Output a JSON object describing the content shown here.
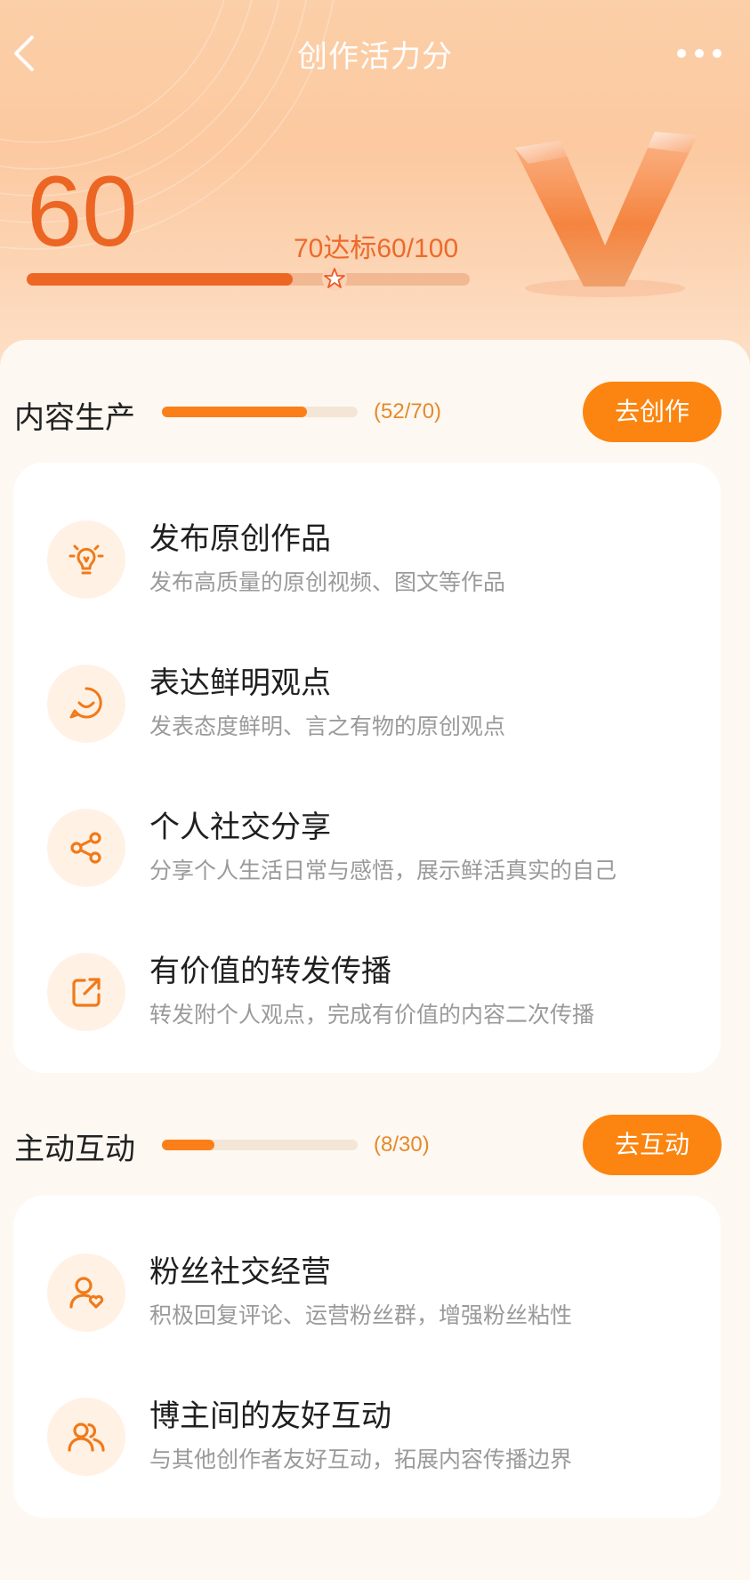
{
  "header": {
    "title": "创作活力分",
    "back_icon": "back-chevron-icon",
    "more_icon": "more-dots-icon"
  },
  "score": {
    "value": "60",
    "target_text": "70达标60/100",
    "current": 60,
    "max": 100,
    "target": 70,
    "logo_icon": "v-badge-icon"
  },
  "sections": [
    {
      "title": "内容生产",
      "count": "(52/70)",
      "progress": 0.743,
      "button": "去创作",
      "items": [
        {
          "title": "发布原创作品",
          "desc": "发布高质量的原创视频、图文等作品",
          "icon": "lightbulb-icon"
        },
        {
          "title": "表达鲜明观点",
          "desc": "发表态度鲜明、言之有物的原创观点",
          "icon": "smile-chat-icon"
        },
        {
          "title": "个人社交分享",
          "desc": "分享个人生活日常与感悟，展示鲜活真实的自己",
          "icon": "share-icon"
        },
        {
          "title": "有价值的转发传播",
          "desc": "转发附个人观点，完成有价值的内容二次传播",
          "icon": "forward-icon"
        }
      ]
    },
    {
      "title": "主动互动",
      "count": "(8/30)",
      "progress": 0.267,
      "button": "去互动",
      "items": [
        {
          "title": "粉丝社交经营",
          "desc": "积极回复评论、运营粉丝群，增强粉丝粘性",
          "icon": "user-heart-icon"
        },
        {
          "title": "博主间的友好互动",
          "desc": "与其他创作者友好互动，拓展内容传播边界",
          "icon": "users-icon"
        }
      ]
    }
  ],
  "colors": {
    "accent": "#fb8510",
    "score": "#ec6523",
    "card": "#ffffff",
    "page": "#fdf8f2"
  }
}
